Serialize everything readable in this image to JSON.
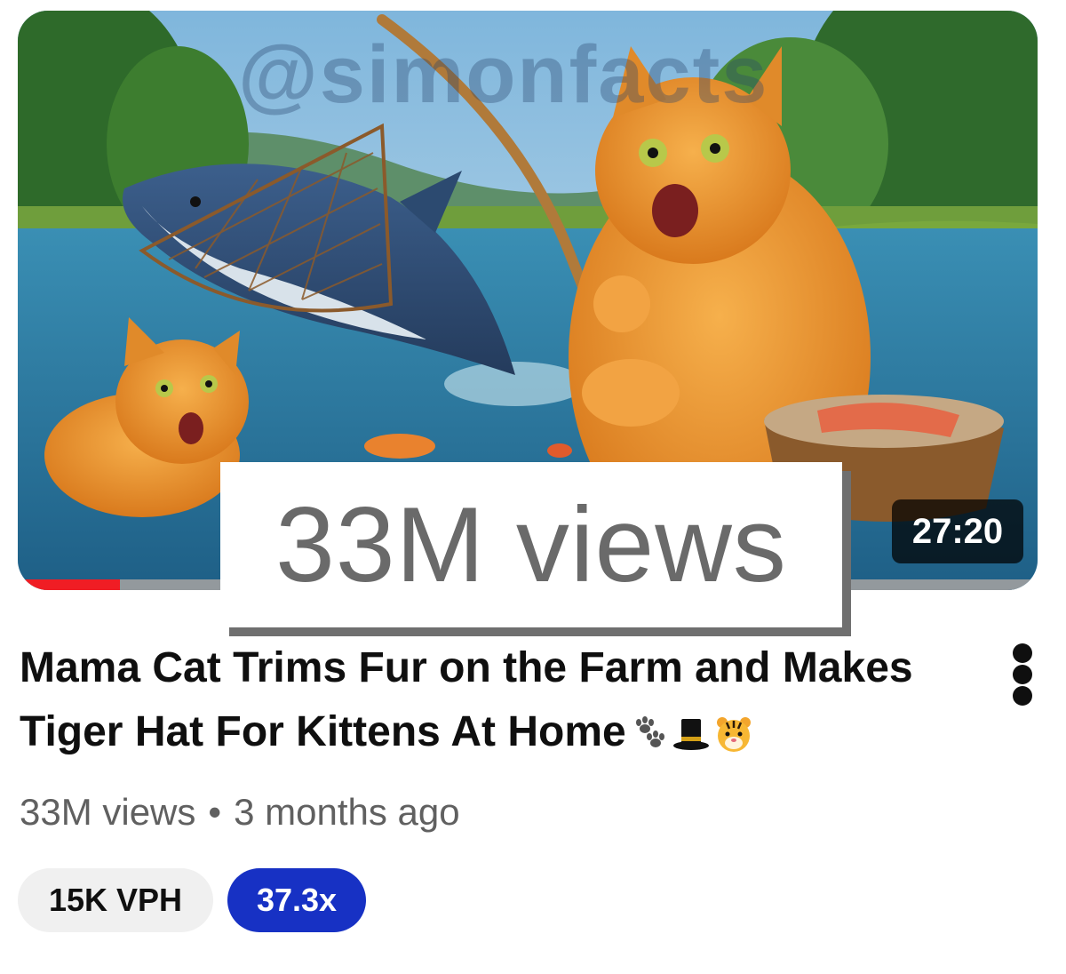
{
  "thumbnail": {
    "watermark": "@simonfacts",
    "duration": "27:20",
    "watch_progress": 0.1,
    "progress_color": "#f01d24"
  },
  "overlay": {
    "views_label": "33M views"
  },
  "video": {
    "title_text": "Mama Cat Trims Fur on the Farm and Makes Tiger Hat For Kittens At Home",
    "title_emojis": [
      "paw-prints-icon",
      "top-hat-icon",
      "tiger-face-icon"
    ],
    "views": "33M views",
    "separator": "•",
    "age": "3 months ago"
  },
  "badges": {
    "vph": "15K VPH",
    "outlier_ratio": "37.3x",
    "ratio_color": "#1731c4"
  },
  "menu": {
    "icon": "more-vertical-icon"
  }
}
